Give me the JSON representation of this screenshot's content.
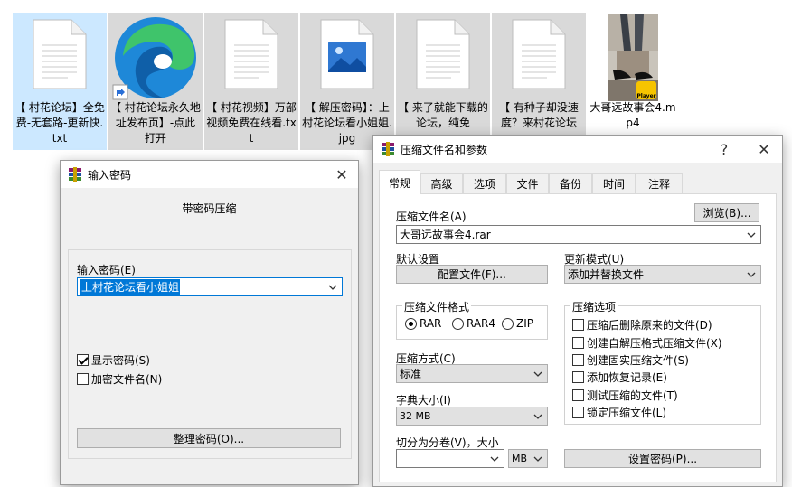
{
  "files": [
    {
      "name": "【 村花论坛】全免费-无套路-更新快.txt",
      "type": "txt",
      "selected": true
    },
    {
      "name": "【 村花论坛永久地址发布页】-点此打开",
      "type": "edge"
    },
    {
      "name": "【 村花视频】万部视频免费在线看.txt",
      "type": "txt"
    },
    {
      "name": "【 解压密码】：上村花论坛看小姐姐.jpg",
      "type": "jpg"
    },
    {
      "name": "【 来了就能下载的论坛，纯免",
      "type": "txt"
    },
    {
      "name": "【 有种子却没速度？来村花论坛",
      "type": "txt"
    },
    {
      "name": "大哥远故事会4.mp4",
      "type": "mp4",
      "badge": "Player"
    }
  ],
  "password_dialog": {
    "title": "输入密码",
    "heading": "带密码压缩",
    "password_label": "输入密码(E)",
    "password_value": "上村花论坛看小姐姐",
    "show_password": "显示密码(S)",
    "show_password_checked": true,
    "encrypt_names": "加密文件名(N)",
    "encrypt_names_checked": false,
    "organize_button": "整理密码(O)...",
    "close_glyph": "✕"
  },
  "archive_dialog": {
    "title": "压缩文件名和参数",
    "help_glyph": "?",
    "close_glyph": "✕",
    "tabs": [
      "常规",
      "高级",
      "选项",
      "文件",
      "备份",
      "时间",
      "注释"
    ],
    "active_tab": 0,
    "archive_name_label": "压缩文件名(A)",
    "browse_button": "浏览(B)...",
    "archive_name_value": "大哥远故事会4.rar",
    "default_settings_label": "默认设置",
    "profiles_button": "配置文件(F)...",
    "update_mode_label": "更新模式(U)",
    "update_mode_value": "添加并替换文件",
    "format_group_title": "压缩文件格式",
    "formats": [
      "RAR",
      "RAR4",
      "ZIP"
    ],
    "format_selected": 0,
    "options_group_title": "压缩选项",
    "options": [
      {
        "label": "压缩后删除原来的文件(D)",
        "checked": false
      },
      {
        "label": "创建自解压格式压缩文件(X)",
        "checked": false
      },
      {
        "label": "创建固实压缩文件(S)",
        "checked": false
      },
      {
        "label": "添加恢复记录(E)",
        "checked": false
      },
      {
        "label": "测试压缩的文件(T)",
        "checked": false
      },
      {
        "label": "锁定压缩文件(L)",
        "checked": false
      }
    ],
    "method_label": "压缩方式(C)",
    "method_value": "标准",
    "dict_label": "字典大小(I)",
    "dict_value": "32 MB",
    "split_label": "切分为分卷(V)，大小",
    "split_value": "",
    "split_unit": "MB",
    "set_password_button": "设置密码(P)..."
  }
}
